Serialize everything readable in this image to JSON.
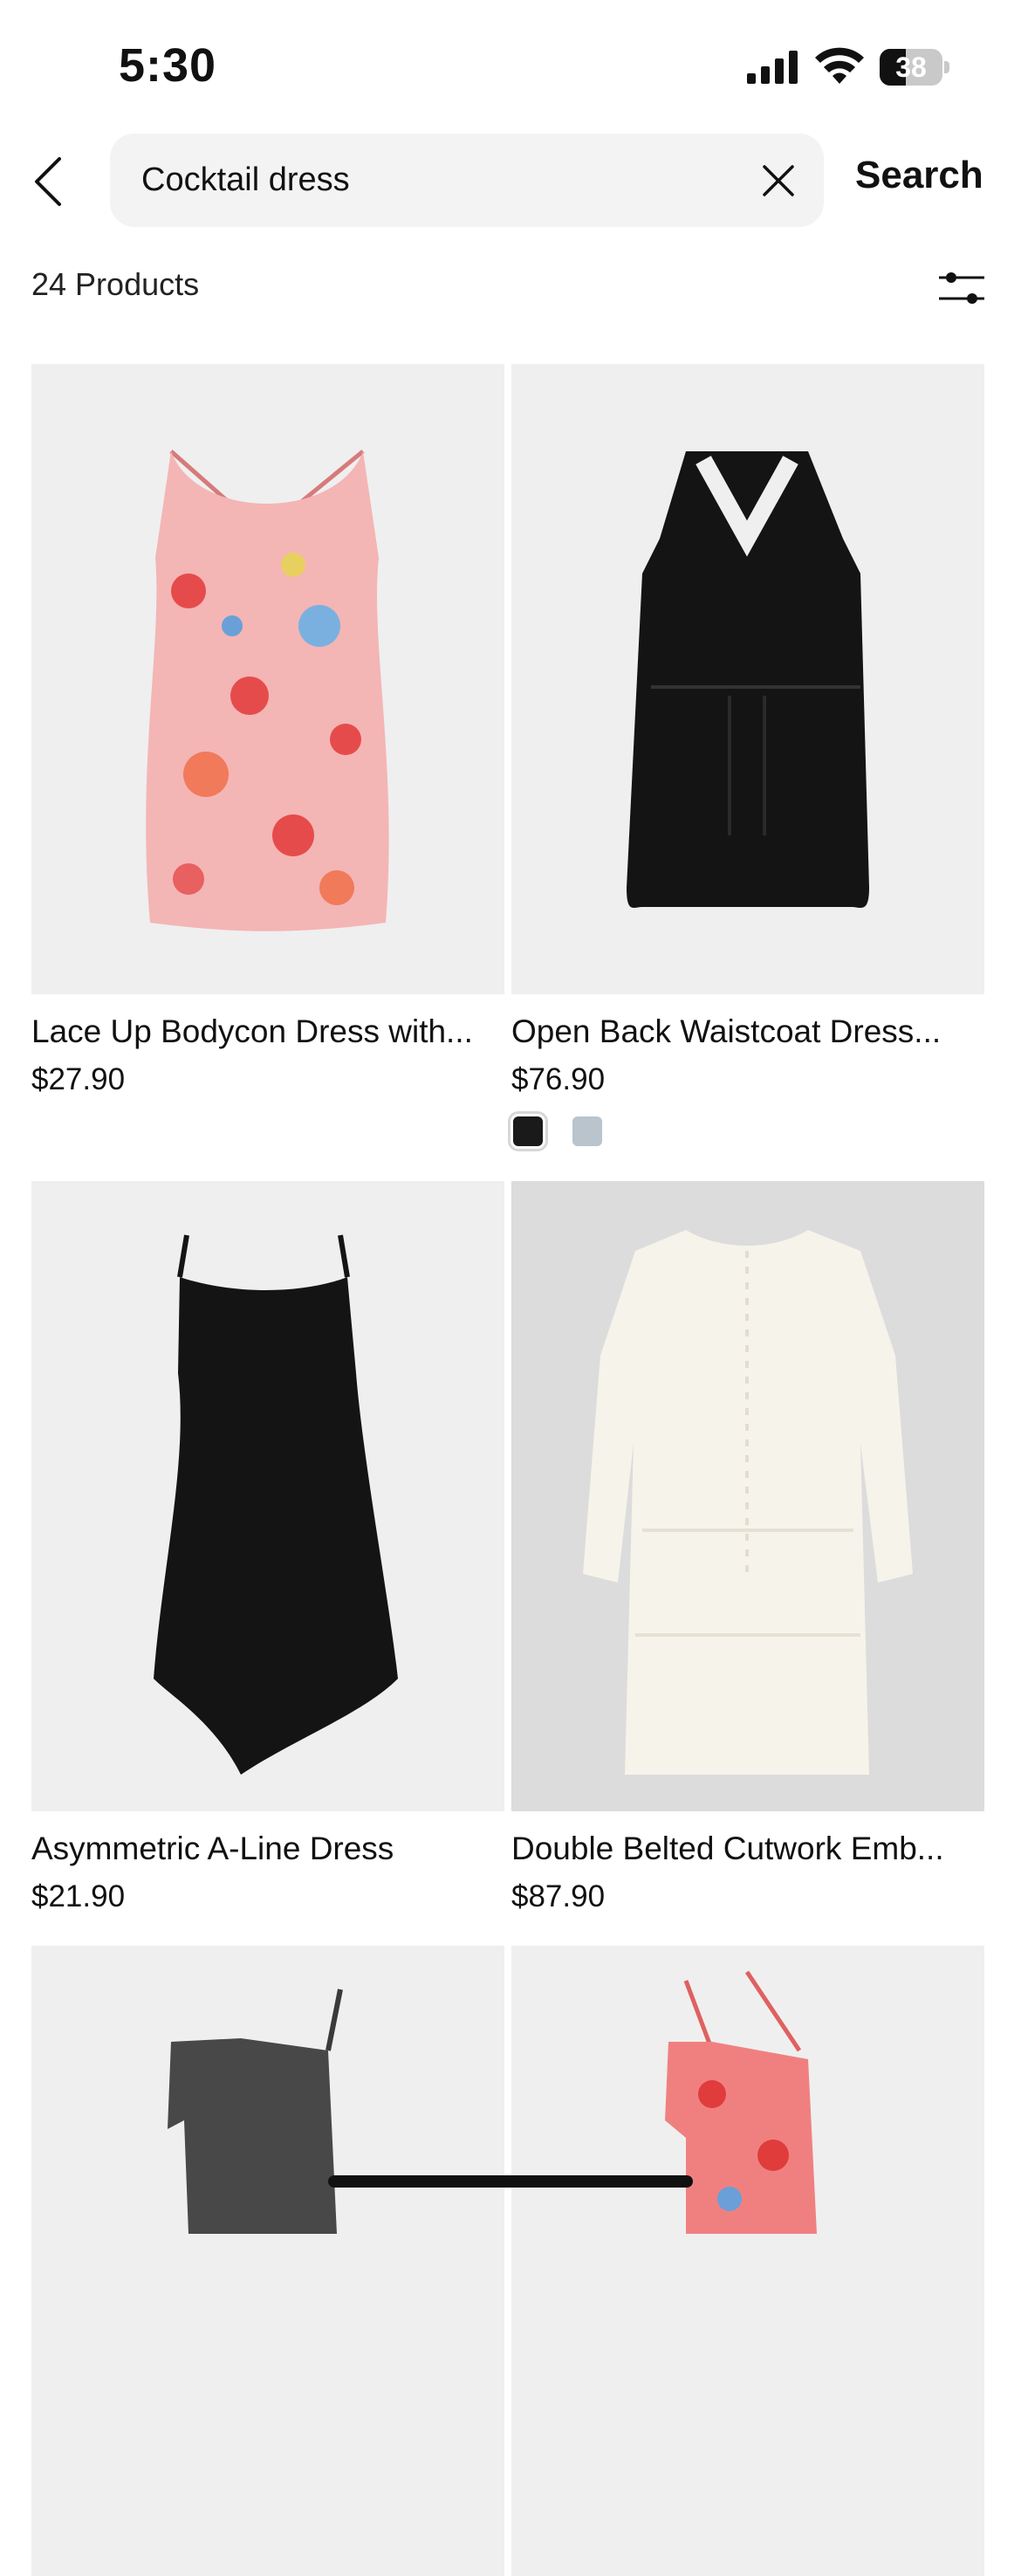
{
  "status_bar": {
    "time": "5:30",
    "battery": "38"
  },
  "search": {
    "query": "Cocktail dress",
    "button_label": "Search"
  },
  "results": {
    "count_label": "24 Products"
  },
  "products": [
    {
      "title": "Lace Up Bodycon Dress with...",
      "price": "$27.90"
    },
    {
      "title": "Open Back Waistcoat Dress...",
      "price": "$76.90",
      "swatches": [
        "#1a1a1a",
        "#b9c4cc"
      ]
    },
    {
      "title": "Asymmetric A-Line Dress",
      "price": "$21.90"
    },
    {
      "title": "Double Belted Cutwork Emb...",
      "price": "$87.90"
    },
    {
      "title": "",
      "price": ""
    },
    {
      "title": "",
      "price": ""
    }
  ]
}
